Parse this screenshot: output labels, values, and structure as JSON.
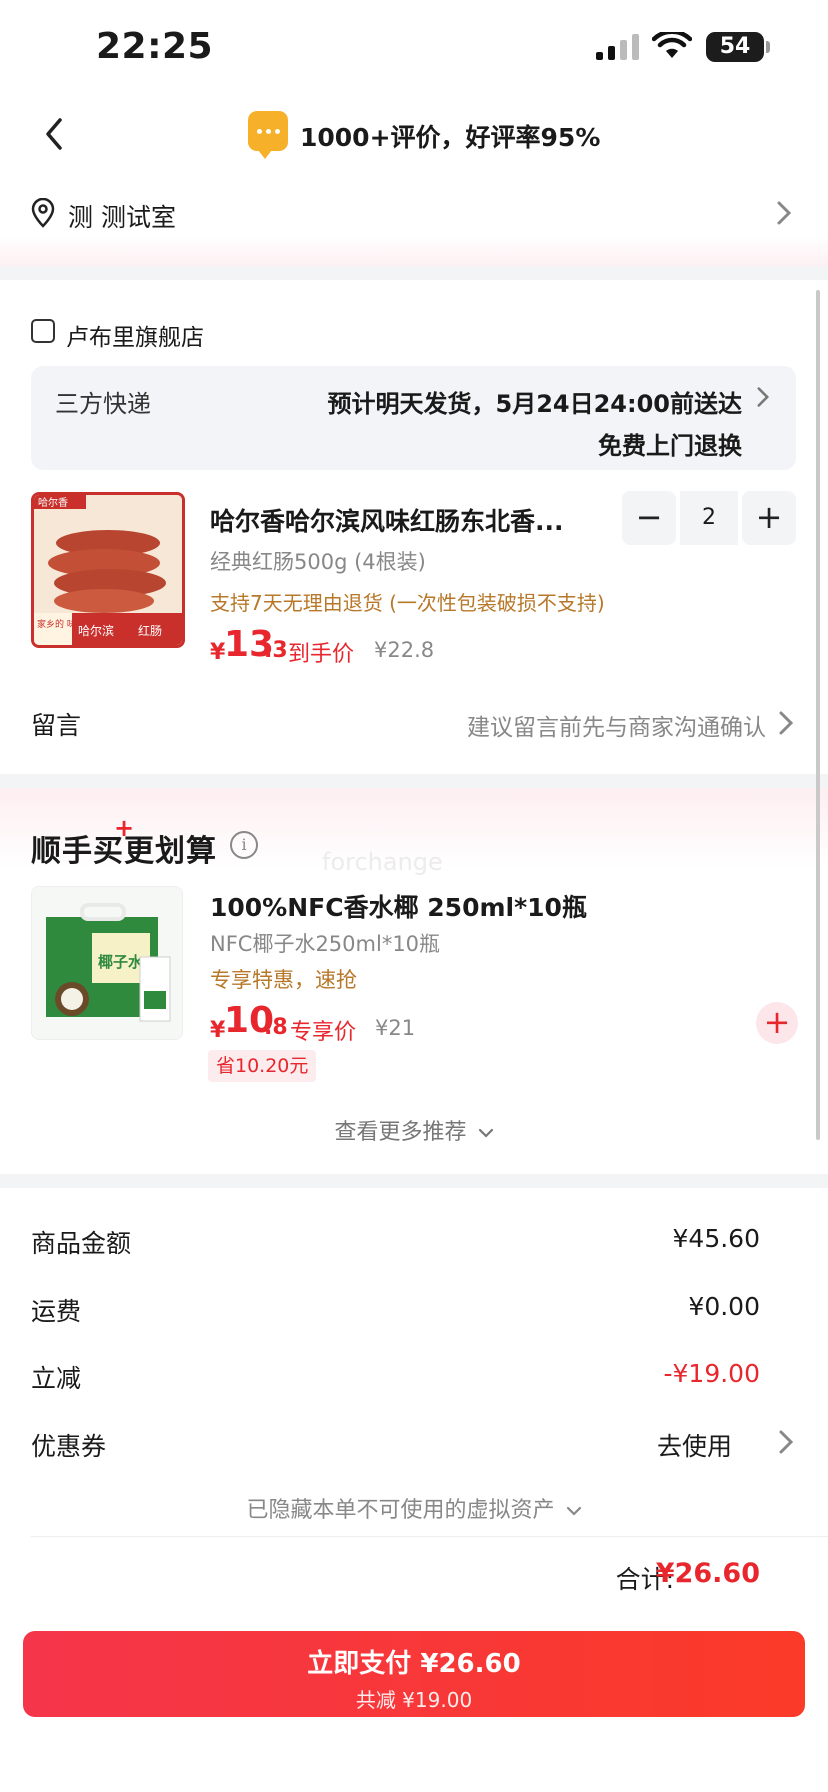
{
  "status_bar": {
    "time": "22:25",
    "battery": "54"
  },
  "header": {
    "rating_text": "1000+评价，好评率95%"
  },
  "address": {
    "text": "测  测试室"
  },
  "store": {
    "name": "卢布里旗舰店",
    "shipping_label": "三方快递",
    "shipping_estimate": "预计明天发货，5月24日24:00前送达",
    "return_policy": "免费上门退换",
    "product": {
      "title": "哈尔香哈尔滨风味红肠东北香...",
      "spec": "经典红肠500g (4根装)",
      "policy": "支持7天无理由退货 (一次性包装破损不支持)",
      "price_symbol": "¥",
      "price_int": "13",
      "price_dec": ".3",
      "price_label": "到手价",
      "original_price": "¥22.8",
      "quantity": "2",
      "image_tag_left": "家乡的\n味道",
      "image_tag_mid": "哈尔滨",
      "image_tag_right": "红肠",
      "image_brand": "哈尔香"
    },
    "message_label": "留言",
    "message_hint": "建议留言前先与商家沟通确认"
  },
  "recommend": {
    "title": "顺手买更划算",
    "plus": "+",
    "watermark": "forchange",
    "item": {
      "name": "100%NFC香水椰 250ml*10瓶",
      "spec": "NFC椰子水250ml*10瓶",
      "promo": "专享特惠，速抢",
      "price_symbol": "¥",
      "price_int": "10",
      "price_dec": ".8",
      "price_label": "专享价",
      "original_price": "¥21",
      "save": "省10.20元",
      "image_text": "椰子水"
    },
    "more": "查看更多推荐"
  },
  "summary": {
    "rows": [
      {
        "label": "商品金额",
        "value": "¥45.60"
      },
      {
        "label": "运费",
        "value": "¥0.00"
      },
      {
        "label": "立减",
        "value": "-¥19.00"
      },
      {
        "label": "优惠券",
        "value": "去使用"
      }
    ],
    "hidden_assets": "已隐藏本单不可使用的虚拟资产",
    "total_label": "合计:",
    "total_value": "¥26.60"
  },
  "pay_button": {
    "main": "立即支付 ¥26.60",
    "sub": "共减 ¥19.00"
  },
  "colors": {
    "accent": "#e8262d",
    "promo": "#b8782a",
    "muted": "#888888"
  }
}
